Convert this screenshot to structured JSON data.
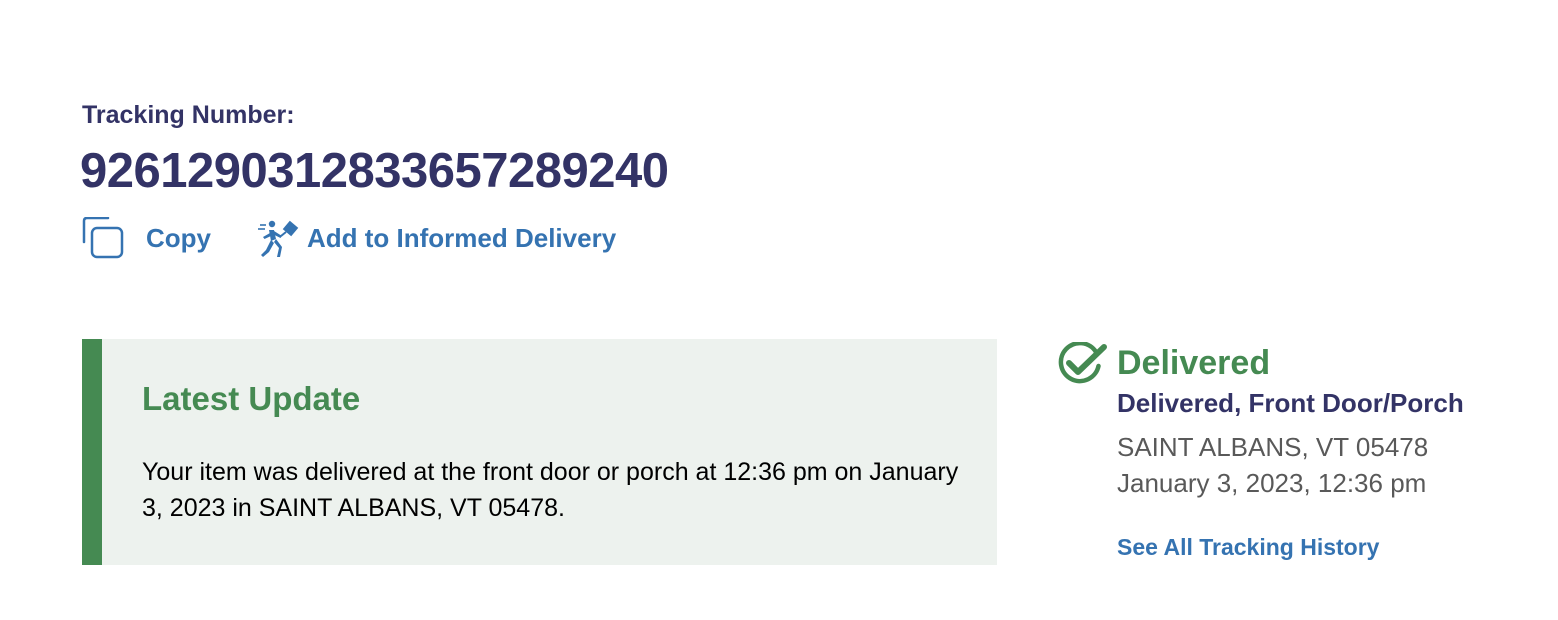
{
  "tracking": {
    "label": "Tracking Number:",
    "number": "9261290312833657289240"
  },
  "actions": {
    "copy_label": "Copy",
    "informed_delivery_label": "Add to Informed Delivery"
  },
  "latest_update": {
    "title": "Latest Update",
    "text": "Your item was delivered at the front door or porch at 12:36 pm on January 3, 2023 in SAINT ALBANS, VT 05478."
  },
  "status": {
    "title": "Delivered",
    "detail": "Delivered, Front Door/Porch",
    "location": "SAINT ALBANS, VT 05478",
    "datetime": "January 3, 2023, 12:36 pm",
    "history_link": "See All Tracking History"
  },
  "icons": {
    "copy": "copy-icon",
    "informed_delivery": "mail-carrier-icon",
    "delivered": "check-circle-icon"
  },
  "colors": {
    "navy": "#333366",
    "link_blue": "#3573b1",
    "green": "#458a52",
    "panel_bg": "#edf2ee",
    "gray_text": "#595959"
  }
}
